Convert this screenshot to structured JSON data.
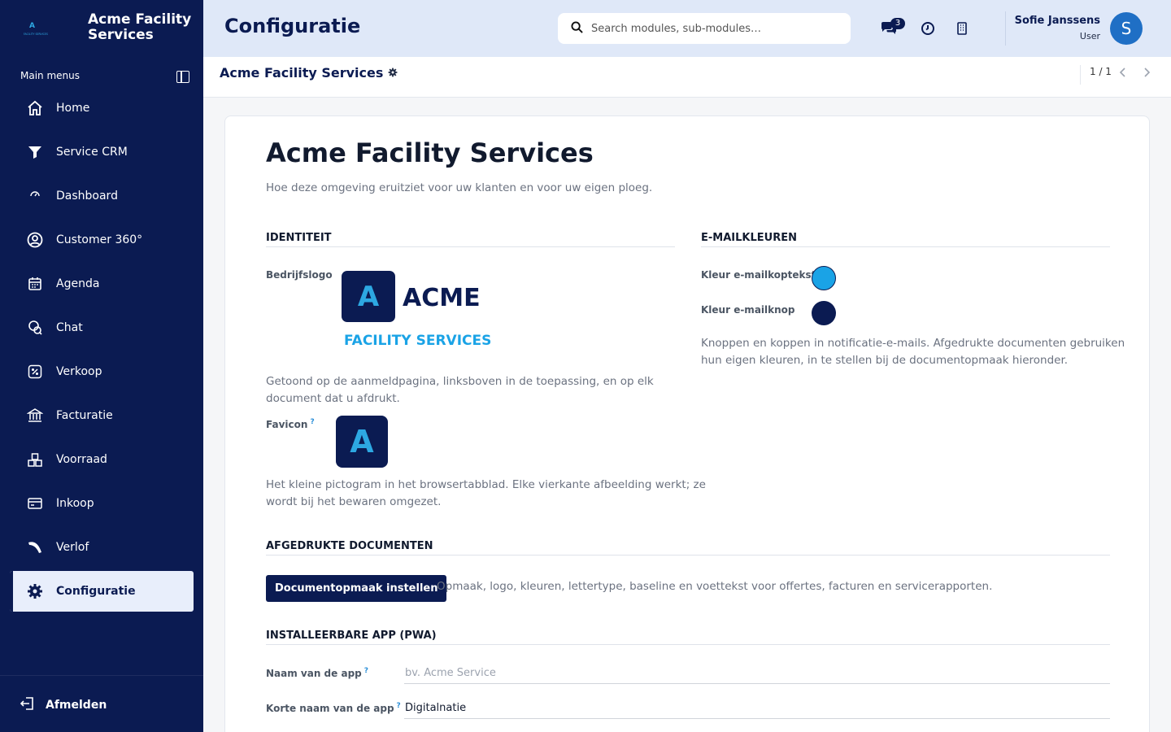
{
  "brand": {
    "name": "Acme Facility Services",
    "logo_small_letter": "A",
    "logo_small_caption": "FACILITY SERVICES"
  },
  "sidebar": {
    "heading": "Main menus",
    "items": [
      {
        "label": "Home",
        "icon": "home-icon"
      },
      {
        "label": "Service CRM",
        "icon": "funnel-icon"
      },
      {
        "label": "Dashboard",
        "icon": "gauge-icon"
      },
      {
        "label": "Customer 360°",
        "icon": "user-circle-icon"
      },
      {
        "label": "Agenda",
        "icon": "calendar-icon"
      },
      {
        "label": "Chat",
        "icon": "chat-icon"
      },
      {
        "label": "Verkoop",
        "icon": "percent-icon"
      },
      {
        "label": "Facturatie",
        "icon": "bank-icon"
      },
      {
        "label": "Voorraad",
        "icon": "boxes-icon"
      },
      {
        "label": "Inkoop",
        "icon": "card-icon"
      },
      {
        "label": "Verlof",
        "icon": "plane-icon"
      },
      {
        "label": "Configuratie",
        "icon": "gear-icon",
        "active": true
      }
    ],
    "logout_label": "Afmelden"
  },
  "header": {
    "title": "Configuratie",
    "search_placeholder": "Search modules, sub-modules…",
    "chat_badge": "3",
    "user_name": "Sofie Janssens",
    "user_role": "User",
    "avatar_letter": "S"
  },
  "breadcrumb": {
    "title": "Acme Facility Services",
    "pager": "1 / 1"
  },
  "main": {
    "title": "Acme Facility Services",
    "subtitle": "Hoe deze omgeving eruitziet voor uw klanten en voor uw eigen ploeg.",
    "identity": {
      "title": "IDENTITEIT",
      "logo_label": "Bedrijfslogo",
      "logo_letter": "A",
      "logo_word": "ACME",
      "logo_tagline": "FACILITY SERVICES",
      "logo_help_1": "Getoond op de aanmeldpagina, linksboven in de toepassing, en op elk",
      "logo_help_2": "document dat u afdrukt.",
      "favicon_label": "Favicon",
      "favicon_letter": "A",
      "favicon_help_1": "Het kleine pictogram in het browsertabblad. Elke vierkante afbeelding werkt; ze",
      "favicon_help_2": "wordt bij het bewaren omgezet."
    },
    "email_colors": {
      "title": "E-MAILKLEUREN",
      "header_label": "Kleur e-mailkoptekst",
      "header_color": "#1aa3e6",
      "button_label": "Kleur e-mailknop",
      "button_color": "#0b1b52",
      "help_1": "Knoppen en koppen in notificatie-e-mails. Afgedrukte documenten gebruiken",
      "help_2": "hun eigen kleuren, in te stellen bij de documentopmaak hieronder."
    },
    "printed_docs": {
      "title": "AFGEDRUKTE DOCUMENTEN",
      "button_label": "Documentopmaak instellen",
      "help": "Opmaak, logo, kleuren, lettertype, baseline en voettekst voor offertes, facturen en servicerapporten."
    },
    "pwa": {
      "title": "INSTALLEERBARE APP (PWA)",
      "app_name_label": "Naam van de app",
      "app_name_value": "",
      "app_name_placeholder": "bv. Acme Service",
      "short_name_label": "Korte naam van de app",
      "short_name_value": "Digitalnatie"
    }
  },
  "colors": {
    "sidebar_bg": "#0b1b52",
    "topbar_bg": "#dfe8f8",
    "accent_blue": "#1aa3e6",
    "active_item_bg": "#e8eefb"
  }
}
